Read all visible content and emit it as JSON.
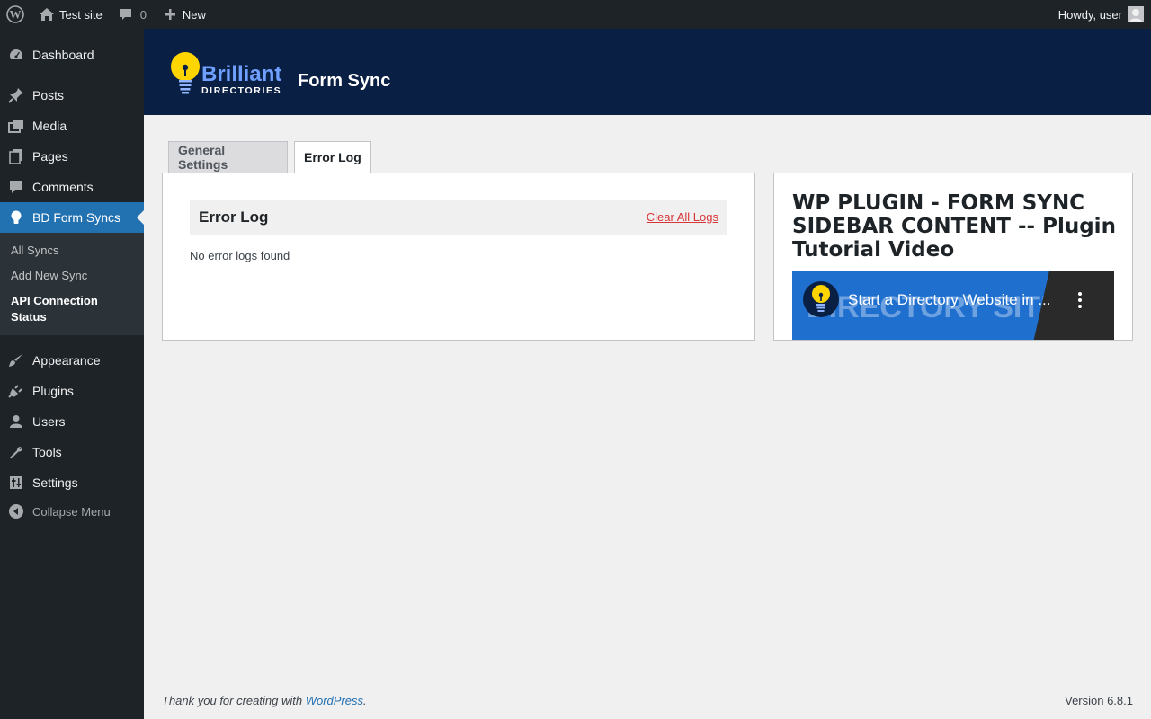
{
  "adminbar": {
    "site_name": "Test site",
    "comments_count": "0",
    "new_label": "New",
    "howdy": "Howdy, user"
  },
  "sidebar": {
    "items": [
      {
        "label": "Dashboard",
        "icon": "dashboard-icon"
      },
      {
        "label": "Posts",
        "icon": "pin-icon"
      },
      {
        "label": "Media",
        "icon": "media-icon"
      },
      {
        "label": "Pages",
        "icon": "pages-icon"
      },
      {
        "label": "Comments",
        "icon": "comment-icon"
      },
      {
        "label": "BD Form Syncs",
        "icon": "lightbulb-icon"
      },
      {
        "label": "Appearance",
        "icon": "brush-icon"
      },
      {
        "label": "Plugins",
        "icon": "plugin-icon"
      },
      {
        "label": "Users",
        "icon": "user-icon"
      },
      {
        "label": "Tools",
        "icon": "wrench-icon"
      },
      {
        "label": "Settings",
        "icon": "sliders-icon"
      }
    ],
    "submenu": [
      "All Syncs",
      "Add New Sync",
      "API Connection Status"
    ],
    "collapse_label": "Collapse Menu"
  },
  "banner": {
    "logo_text": "Brilliant",
    "logo_subtext": "DIRECTORIES",
    "title": "Form Sync"
  },
  "tabs": [
    {
      "label": "General Settings",
      "active": false
    },
    {
      "label": "Error Log",
      "active": true
    }
  ],
  "error_log": {
    "title": "Error Log",
    "clear_label": "Clear All Logs",
    "empty_message": "No error logs found"
  },
  "side_panel": {
    "title": "WP PLUGIN - FORM SYNC SIDEBAR CONTENT -- Plugin Tutorial Video",
    "video_title": "Start a Directory Website in ...",
    "video_bg_text": "DIRECTORY SITE SETUP IN"
  },
  "footer": {
    "thanks_prefix": "Thank you for creating with ",
    "thanks_link": "WordPress",
    "thanks_suffix": ".",
    "version": "Version 6.8.1"
  },
  "colors": {
    "admin_dark": "#1d2327",
    "accent_blue": "#2271b1",
    "banner_navy": "#0a1f44",
    "link_red": "#d63638",
    "bulb_yellow": "#ffd500"
  }
}
